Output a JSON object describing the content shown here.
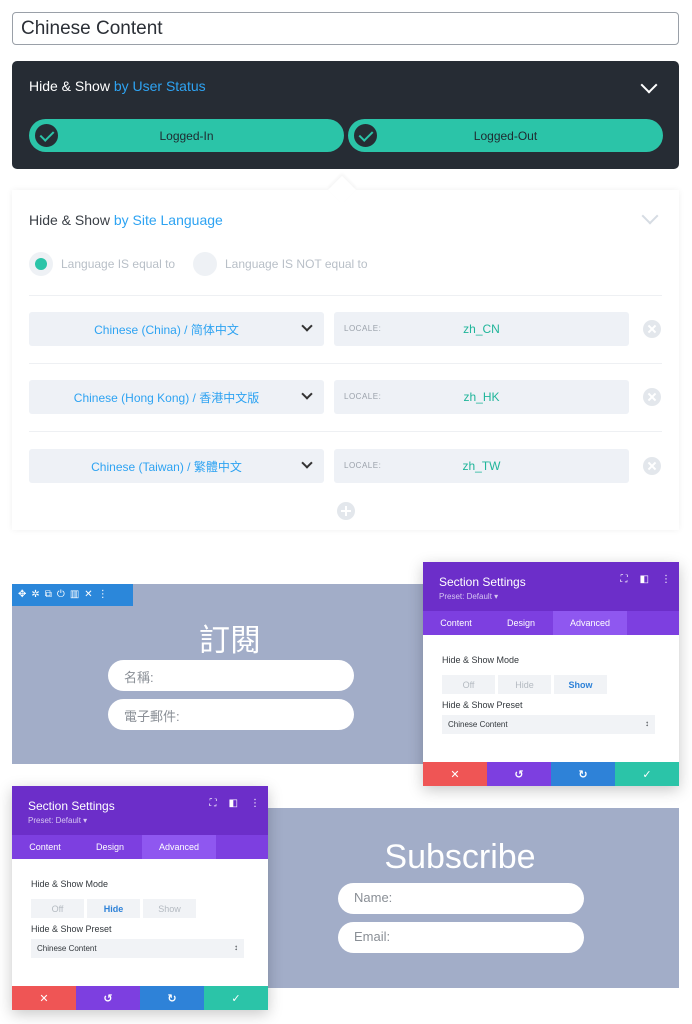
{
  "title_field": {
    "value": "Chinese Content"
  },
  "user_status": {
    "title_prefix": "Hide & Show",
    "title_highlight": "by User Status",
    "options": [
      {
        "label": "Logged-In",
        "checked": true
      },
      {
        "label": "Logged-Out",
        "checked": true
      }
    ]
  },
  "site_language": {
    "title_prefix": "Hide & Show",
    "title_highlight": "by Site Language",
    "radio_equal": "Language IS equal to",
    "radio_not_equal": "Language IS NOT equal to",
    "locale_label": "LOCALE:",
    "rows": [
      {
        "language": "Chinese (China) / 简体中文",
        "locale": "zh_CN"
      },
      {
        "language": "Chinese (Hong Kong) / 香港中文版",
        "locale": "zh_HK"
      },
      {
        "language": "Chinese (Taiwan) / 繁體中文",
        "locale": "zh_TW"
      }
    ]
  },
  "cn_section": {
    "heading": "訂閱",
    "name_placeholder": "名稱:",
    "email_placeholder": "電子郵件:"
  },
  "en_section": {
    "heading": "Subscribe",
    "name_placeholder": "Name:",
    "email_placeholder": "Email:"
  },
  "modal_show": {
    "title": "Section Settings",
    "preset": "Preset: Default ▾",
    "tabs": [
      "Content",
      "Design",
      "Advanced"
    ],
    "active_tab": "Advanced",
    "mode_label": "Hide & Show Mode",
    "modes": [
      "Off",
      "Hide",
      "Show"
    ],
    "selected_mode": "Show",
    "preset_label": "Hide & Show Preset",
    "preset_value": "Chinese Content"
  },
  "modal_hide": {
    "title": "Section Settings",
    "preset": "Preset: Default ▾",
    "tabs": [
      "Content",
      "Design",
      "Advanced"
    ],
    "active_tab": "Advanced",
    "mode_label": "Hide & Show Mode",
    "modes": [
      "Off",
      "Hide",
      "Show"
    ],
    "selected_mode": "Hide",
    "preset_label": "Hide & Show Preset",
    "preset_value": "Chinese Content"
  },
  "colors": {
    "accent_teal": "#2bc4a8",
    "accent_blue": "#2ea3f2",
    "modal_purple": "#6c2ec9",
    "section_bg": "#a2adc8"
  }
}
